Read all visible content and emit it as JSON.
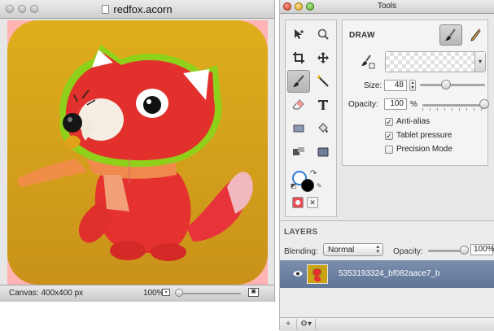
{
  "image_window": {
    "title": "redfox.acorn",
    "status": {
      "canvas_size": "Canvas: 400x400 px",
      "zoom": "100%",
      "zoom_level": 0.05
    },
    "canvas_bg_color": "#ffb3b3"
  },
  "tools_window": {
    "title": "Tools",
    "tool_icons": [
      "select-arrow-icon",
      "zoom-magnifier-icon",
      "crop-icon",
      "move-icon",
      "brush-icon",
      "magic-wand-icon",
      "eraser-icon",
      "text-tool-icon",
      "rectangle-shape-icon",
      "paint-bucket-icon",
      "gradient-icon",
      "rounded-rect-icon"
    ],
    "selected_tool": "brush-icon",
    "draw_panel": {
      "title": "DRAW",
      "size_label": "Size:",
      "size_value": "48",
      "size_level": 0.4,
      "opacity_label": "Opacity:",
      "opacity_value": "100",
      "opacity_unit": "%",
      "opacity_level": 1.0,
      "checkboxes": [
        {
          "label": "Anti-alias",
          "checked": true
        },
        {
          "label": "Tablet pressure",
          "checked": true
        },
        {
          "label": "Precision Mode",
          "checked": false
        }
      ]
    },
    "layers": {
      "title": "LAYERS",
      "blending_label": "Blending:",
      "blending_value": "Normal",
      "opacity_label": "Opacity:",
      "opacity_value": "100%",
      "opacity_level": 1.0,
      "items": [
        {
          "name": "5353193324_bf082aace7_b",
          "visible": true
        }
      ],
      "footer": {
        "add": "+",
        "gear": "⚙▾"
      }
    }
  },
  "colors": {
    "selection_bg": "#6a80a3",
    "photo_bg": "#d7a51a",
    "fox_red": "#e2312c"
  }
}
